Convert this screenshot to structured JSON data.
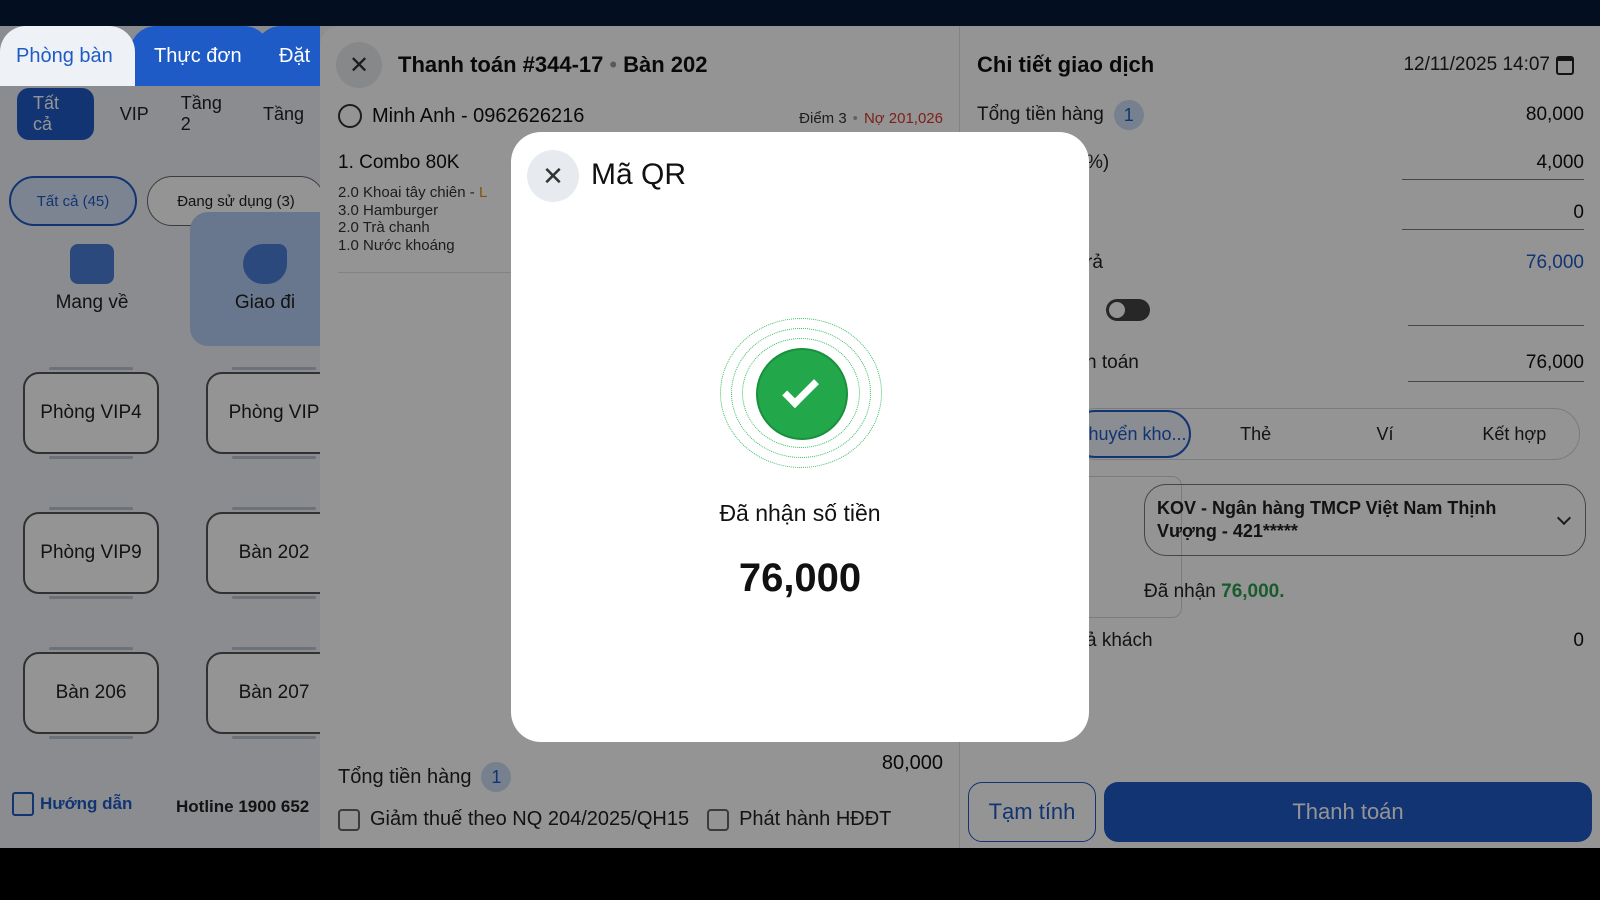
{
  "left": {
    "main_tabs": [
      "Phòng bàn",
      "Thực đơn",
      "Đặt"
    ],
    "filters": [
      "Tất cả",
      "VIP",
      "Tầng 2",
      "Tầng"
    ],
    "chips": [
      "Tất cả (45)",
      "Đang sử dụng (3)"
    ],
    "quick": [
      "Mang về",
      "Giao đi"
    ],
    "tables": [
      "Phòng VIP4",
      "Phòng VIP",
      "Phòng VIP9",
      "Bàn 202",
      "Bàn 206",
      "Bàn 207"
    ],
    "guide": "Hướng dẫn",
    "hotline": "Hotline 1900 652"
  },
  "middle": {
    "title": "Thanh toán #344-17",
    "table": "Bàn 202",
    "customer": "Minh Anh - 0962626216",
    "points": "Điểm 3",
    "debt": "Nợ 201,026",
    "item": "1. Combo 80K",
    "sub_items": [
      {
        "qty": "2.0",
        "name": "Khoai tây chiên",
        "size": "L"
      },
      {
        "qty": "3.0",
        "name": "Hamburger",
        "size": ""
      },
      {
        "qty": "2.0",
        "name": "Trà chanh",
        "size": ""
      },
      {
        "qty": "1.0",
        "name": "Nước khoáng",
        "size": ""
      }
    ],
    "total_label": "Tổng tiền hàng",
    "total_count": "1",
    "total_value": "80,000",
    "check_tax": "Giảm thuế theo NQ 204/2025/QH15",
    "check_invoice": "Phát hành HĐĐT"
  },
  "right": {
    "title": "Chi tiết giao dịch",
    "datetime": "12/11/2025 14:07",
    "total_label": "Tổng tiền hàng",
    "total_count": "1",
    "total_value": "80,000",
    "discount_partial": "%)",
    "discount_value": "4,000",
    "other_value": "0",
    "pay_partial": "rả",
    "pay_value": "76,000",
    "paid_partial": "n toán",
    "paid_value": "76,000",
    "methods": [
      "Chuyển kho...",
      "Thẻ",
      "Ví",
      "Kết hợp"
    ],
    "bank": "KOV - Ngân hàng TMCP Việt Nam Thịnh Vượng - 421*****",
    "received_label": "Đã nhận",
    "received_amount": "76,000.",
    "change_partial": "ả khách",
    "change_value": "0",
    "btn_temp": "Tạm tính",
    "btn_pay": "Thanh toán"
  },
  "modal": {
    "title": "Mã QR",
    "received_label": "Đã nhận số tiền",
    "amount": "76,000"
  },
  "colors": {
    "primary": "#1f5bc6",
    "success": "#22a84a",
    "debt": "#d9372b"
  }
}
